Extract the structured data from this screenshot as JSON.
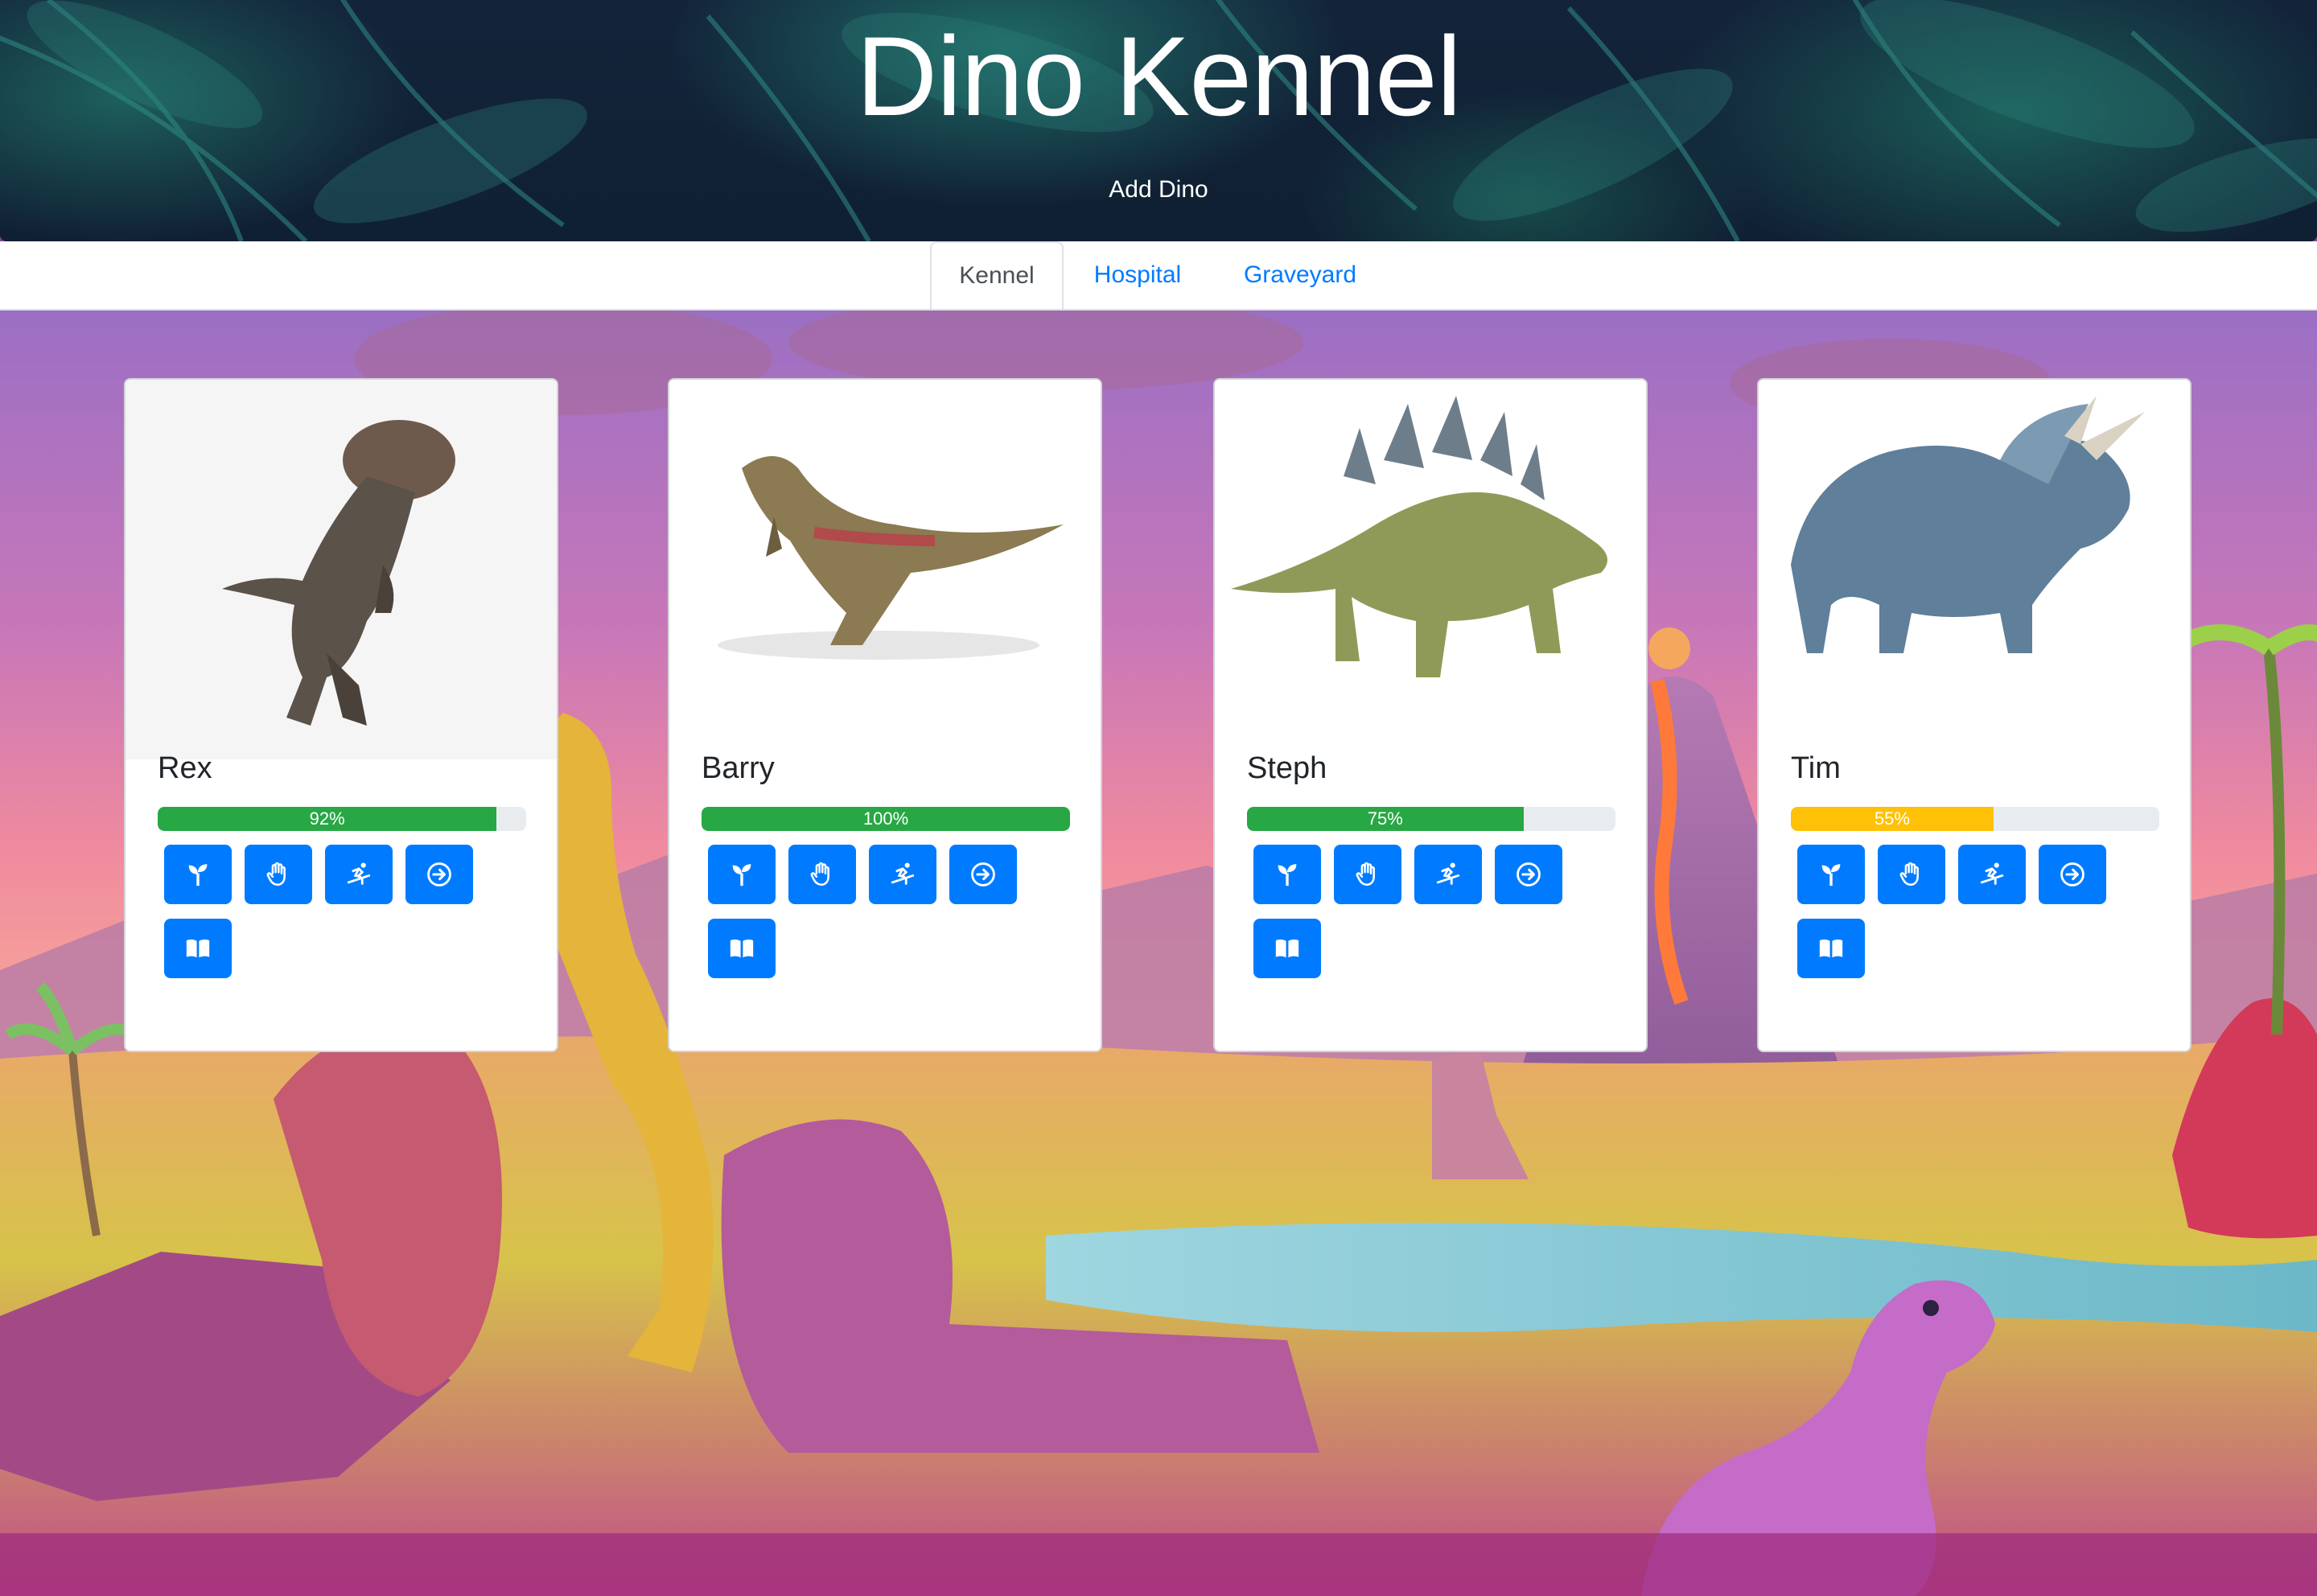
{
  "header": {
    "title": "Dino Kennel",
    "add_label": "Add Dino"
  },
  "tabs": [
    {
      "label": "Kennel",
      "active": true
    },
    {
      "label": "Hospital",
      "active": false
    },
    {
      "label": "Graveyard",
      "active": false
    }
  ],
  "dinos": [
    {
      "name": "Rex",
      "health": "92%",
      "health_value": 92,
      "bar_color": "#28a745"
    },
    {
      "name": "Barry",
      "health": "100%",
      "health_value": 100,
      "bar_color": "#28a745"
    },
    {
      "name": "Steph",
      "health": "75%",
      "health_value": 75,
      "bar_color": "#28a745"
    },
    {
      "name": "Tim",
      "health": "55%",
      "health_value": 55,
      "bar_color": "#ffc107"
    }
  ],
  "actions": [
    "seedling-icon",
    "hand-icon",
    "snowboarding-icon",
    "arrow-circle-right-icon",
    "book-open-icon"
  ],
  "colors": {
    "primary": "#007bff",
    "success": "#28a745",
    "warning": "#ffc107",
    "header_bg": "#102033"
  }
}
